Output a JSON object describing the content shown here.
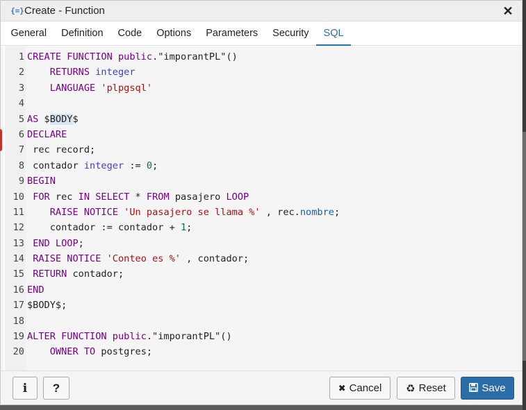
{
  "window": {
    "title": "Create - Function",
    "icon": "function-braces-icon",
    "icon_glyph": "{=}",
    "close_glyph": "✕"
  },
  "tabs": [
    {
      "label": "General",
      "active": false
    },
    {
      "label": "Definition",
      "active": false
    },
    {
      "label": "Code",
      "active": false
    },
    {
      "label": "Options",
      "active": false
    },
    {
      "label": "Parameters",
      "active": false
    },
    {
      "label": "Security",
      "active": false
    },
    {
      "label": "SQL",
      "active": true
    }
  ],
  "sql_lines": [
    {
      "n": "1",
      "tokens": [
        {
          "t": "CREATE FUNCTION public",
          "c": "kw"
        },
        {
          "t": ".\"imporantPL\"()",
          "c": ""
        }
      ]
    },
    {
      "n": "2",
      "tokens": [
        {
          "t": "    ",
          "c": ""
        },
        {
          "t": "RETURNS",
          "c": "kw"
        },
        {
          "t": " ",
          "c": ""
        },
        {
          "t": "integer",
          "c": "ty"
        }
      ]
    },
    {
      "n": "3",
      "tokens": [
        {
          "t": "    ",
          "c": ""
        },
        {
          "t": "LANGUAGE",
          "c": "kw"
        },
        {
          "t": " ",
          "c": ""
        },
        {
          "t": "'plpgsql'",
          "c": "st"
        }
      ]
    },
    {
      "n": "4",
      "tokens": []
    },
    {
      "n": "5",
      "tokens": [
        {
          "t": "AS",
          "c": "kw"
        },
        {
          "t": " $",
          "c": ""
        },
        {
          "t": "BODY",
          "c": "hl"
        },
        {
          "t": "$",
          "c": ""
        }
      ]
    },
    {
      "n": "6",
      "tokens": [
        {
          "t": "DECLARE",
          "c": "kw"
        }
      ]
    },
    {
      "n": "7",
      "tokens": [
        {
          "t": " rec record;",
          "c": ""
        }
      ]
    },
    {
      "n": "8",
      "tokens": [
        {
          "t": " contador ",
          "c": ""
        },
        {
          "t": "integer",
          "c": "ty"
        },
        {
          "t": " := ",
          "c": ""
        },
        {
          "t": "0",
          "c": "nu"
        },
        {
          "t": ";",
          "c": ""
        }
      ]
    },
    {
      "n": "9",
      "tokens": [
        {
          "t": "BEGIN",
          "c": "kw"
        }
      ]
    },
    {
      "n": "10",
      "tokens": [
        {
          "t": " ",
          "c": ""
        },
        {
          "t": "FOR",
          "c": "kw"
        },
        {
          "t": " rec ",
          "c": ""
        },
        {
          "t": "IN SELECT",
          "c": "kw"
        },
        {
          "t": " * ",
          "c": ""
        },
        {
          "t": "FROM",
          "c": "kw"
        },
        {
          "t": " pasajero ",
          "c": ""
        },
        {
          "t": "LOOP",
          "c": "kw"
        }
      ]
    },
    {
      "n": "11",
      "tokens": [
        {
          "t": "    ",
          "c": ""
        },
        {
          "t": "RAISE NOTICE",
          "c": "kw"
        },
        {
          "t": " ",
          "c": ""
        },
        {
          "t": "'Un pasajero se llama %'",
          "c": "st"
        },
        {
          "t": " , rec.",
          "c": ""
        },
        {
          "t": "nombre",
          "c": "pr"
        },
        {
          "t": ";",
          "c": ""
        }
      ]
    },
    {
      "n": "12",
      "tokens": [
        {
          "t": "    contador := contador + ",
          "c": ""
        },
        {
          "t": "1",
          "c": "nu"
        },
        {
          "t": ";",
          "c": ""
        }
      ]
    },
    {
      "n": "13",
      "tokens": [
        {
          "t": " ",
          "c": ""
        },
        {
          "t": "END LOOP",
          "c": "kw"
        },
        {
          "t": ";",
          "c": ""
        }
      ]
    },
    {
      "n": "14",
      "tokens": [
        {
          "t": " ",
          "c": ""
        },
        {
          "t": "RAISE NOTICE",
          "c": "kw"
        },
        {
          "t": " ",
          "c": ""
        },
        {
          "t": "'Conteo es %'",
          "c": "st"
        },
        {
          "t": " , contador;",
          "c": ""
        }
      ]
    },
    {
      "n": "15",
      "tokens": [
        {
          "t": " ",
          "c": ""
        },
        {
          "t": "RETURN",
          "c": "kw"
        },
        {
          "t": " contador;",
          "c": ""
        }
      ]
    },
    {
      "n": "16",
      "tokens": [
        {
          "t": "END",
          "c": "kw"
        }
      ]
    },
    {
      "n": "17",
      "tokens": [
        {
          "t": "$BODY$;",
          "c": ""
        }
      ]
    },
    {
      "n": "18",
      "tokens": []
    },
    {
      "n": "19",
      "tokens": [
        {
          "t": "ALTER FUNCTION public",
          "c": "kw"
        },
        {
          "t": ".\"imporantPL\"()",
          "c": ""
        }
      ]
    },
    {
      "n": "20",
      "tokens": [
        {
          "t": "    ",
          "c": ""
        },
        {
          "t": "OWNER TO",
          "c": "kw"
        },
        {
          "t": " postgres;",
          "c": ""
        }
      ]
    }
  ],
  "footer": {
    "info_glyph": "i",
    "help_glyph": "?",
    "cancel_label": "Cancel",
    "reset_label": "Reset",
    "save_label": "Save",
    "cancel_icon": "close-icon",
    "reset_icon": "recycle-icon",
    "save_icon": "floppy-disk-icon"
  },
  "colors": {
    "keyword": "#770088",
    "type": "#3e3ecc",
    "string": "#aa1111",
    "number": "#116644",
    "property": "#1a5fa8",
    "active_tab": "#2c6ea8",
    "save_button": "#2b6da8"
  }
}
